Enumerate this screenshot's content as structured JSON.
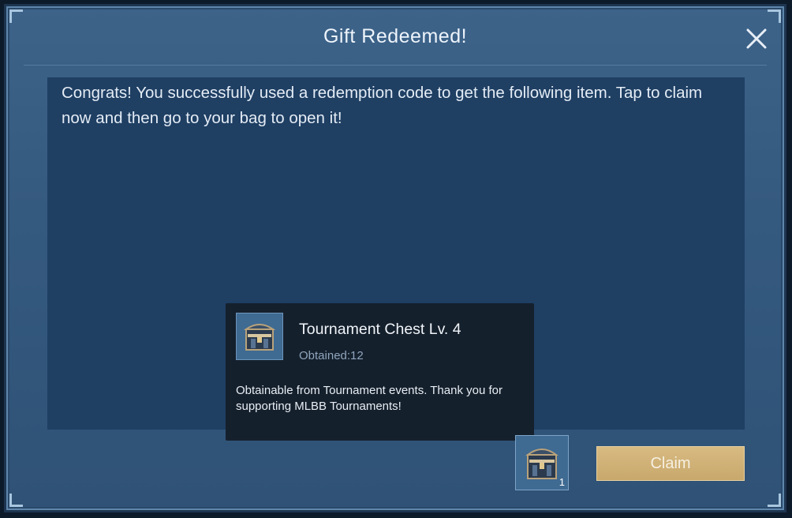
{
  "dialog": {
    "title": "Gift Redeemed!",
    "close_icon": "close-icon",
    "message": "Congrats! You successfully used a redemption code to get the following item. Tap to claim now and then go to your bag to open it!"
  },
  "tooltip": {
    "item_name": "Tournament Chest Lv. 4",
    "obtained": "Obtained:12",
    "description": "Obtainable from Tournament events. Thank you for supporting MLBB Tournaments!",
    "icon": "chest-icon"
  },
  "reward": {
    "icon": "chest-icon",
    "quantity": "1"
  },
  "actions": {
    "claim_label": "Claim"
  },
  "colors": {
    "accent": "#c8a86c",
    "panel": "#1f3f63",
    "dialog": "#355a80"
  }
}
